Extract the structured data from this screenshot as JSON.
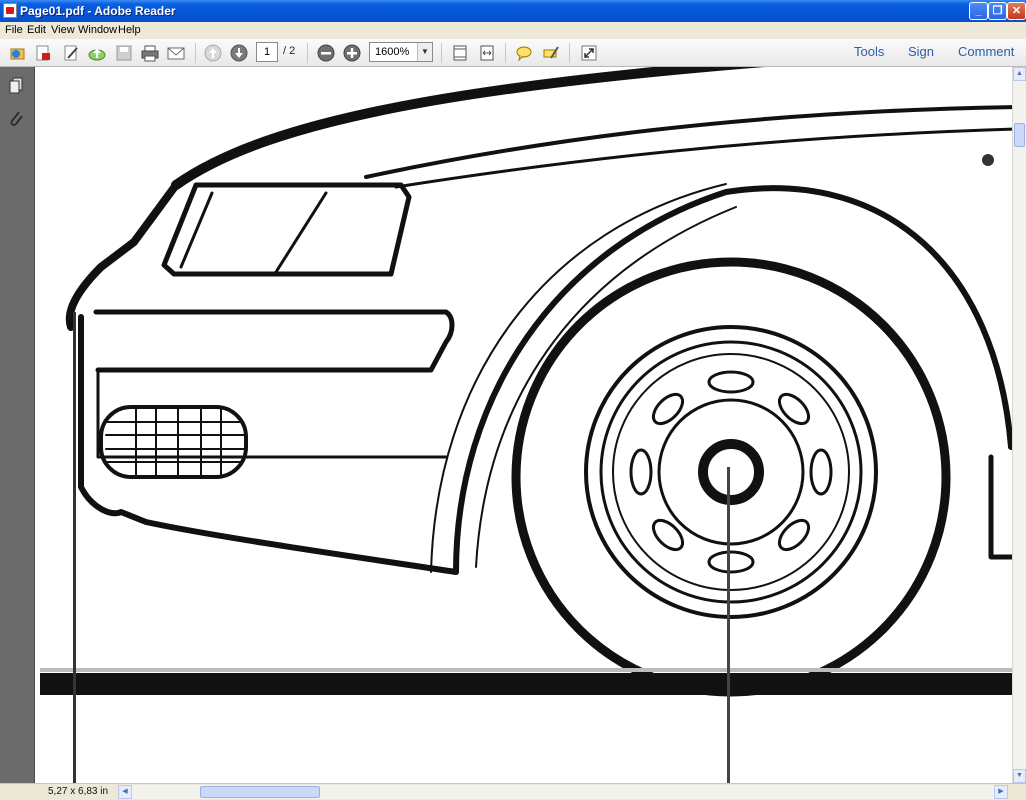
{
  "window": {
    "title": "Page01.pdf - Adobe Reader"
  },
  "menu": {
    "file": "File",
    "edit": "Edit",
    "view": "View",
    "window": "Window",
    "help": "Help"
  },
  "toolbar": {
    "page_current": "1",
    "page_total": "/ 2",
    "zoom": "1600%",
    "tools": "Tools",
    "sign": "Sign",
    "comment": "Comment"
  },
  "status": {
    "page_size": "5,27 x 6,83 in"
  },
  "colors": {
    "titlebar": "#0654d8",
    "left_panel": "#6b6b6b",
    "link": "#2b5ea8"
  }
}
